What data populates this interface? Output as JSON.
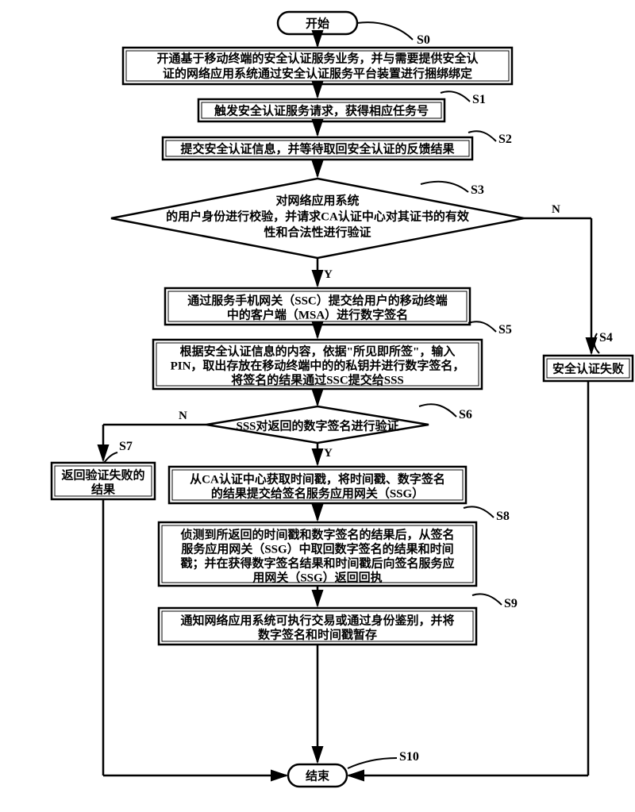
{
  "chart_data": {
    "type": "flowchart",
    "title": "",
    "nodes": [
      {
        "id": "start",
        "shape": "terminator",
        "text": "开始"
      },
      {
        "id": "S0",
        "shape": "process",
        "label": "S0",
        "text": "开通基于移动终端的安全认证服务业务，并与需要提供安全认证的网络应用系统通过安全认证服务平台装置进行捆绑绑定"
      },
      {
        "id": "S1",
        "shape": "process",
        "label": "S1",
        "text": "触发安全认证服务请求，获得相应任务号"
      },
      {
        "id": "S2",
        "shape": "process",
        "label": "S2",
        "text": "提交安全认证信息，并等待取回安全认证的反馈结果"
      },
      {
        "id": "S3",
        "shape": "decision",
        "label": "S3",
        "text": "对网络应用系统的用户身份进行校验，并请求CA认证中心对其证书的有效性和合法性进行验证"
      },
      {
        "id": "S3_Y",
        "shape": "process",
        "text": "通过服务手机网关（SSC）提交给用户的移动终端中的客户端（MSA）进行数字签名"
      },
      {
        "id": "S4",
        "shape": "process",
        "label": "S4",
        "text": "安全认证失败"
      },
      {
        "id": "S5",
        "shape": "process",
        "label": "S5",
        "text": "根据安全认证信息的内容，依据\"所见即所签\"，输入PIN，取出存放在移动终端中的的私钥并进行数字签名，将签名的结果通过SSC提交给SSS"
      },
      {
        "id": "S6",
        "shape": "decision",
        "label": "S6",
        "text": "SSS对返回的数字签名进行验证"
      },
      {
        "id": "S7",
        "shape": "process",
        "label": "S7",
        "text": "返回验证失败的结果"
      },
      {
        "id": "S6_Y",
        "shape": "process",
        "text": "从CA认证中心获取时间戳，将时间戳、数字签名的结果提交给签名服务应用网关（SSG）"
      },
      {
        "id": "S8",
        "shape": "process",
        "label": "S8",
        "text": "侦测到所返回的时间戳和数字签名的结果后，从签名服务应用网关（SSG）中取回数字签名的结果和时间戳；并在获得数字签名结果和时间戳后向签名服务应用网关（SSG）返回回执"
      },
      {
        "id": "S9",
        "shape": "process",
        "label": "S9",
        "text": "通知网络应用系统可执行交易或通过身份鉴别，并将数字签名和时间戳暂存"
      },
      {
        "id": "end",
        "shape": "terminator",
        "label": "S10",
        "text": "结束"
      }
    ],
    "edges": [
      {
        "from": "start",
        "to": "S0"
      },
      {
        "from": "S0",
        "to": "S1"
      },
      {
        "from": "S1",
        "to": "S2"
      },
      {
        "from": "S2",
        "to": "S3"
      },
      {
        "from": "S3",
        "to": "S3_Y",
        "label": "Y"
      },
      {
        "from": "S3",
        "to": "S4",
        "label": "N"
      },
      {
        "from": "S3_Y",
        "to": "S5"
      },
      {
        "from": "S5",
        "to": "S6"
      },
      {
        "from": "S6",
        "to": "S6_Y",
        "label": "Y"
      },
      {
        "from": "S6",
        "to": "S7",
        "label": "N"
      },
      {
        "from": "S6_Y",
        "to": "S8"
      },
      {
        "from": "S8",
        "to": "S9"
      },
      {
        "from": "S9",
        "to": "end"
      },
      {
        "from": "S4",
        "to": "end"
      },
      {
        "from": "S7",
        "to": "end"
      }
    ]
  },
  "start": "开始",
  "end": "结束",
  "S0_l1": "开通基于移动终端的安全认证服务业务，并与需要提供安全认",
  "S0_l2": "证的网络应用系统通过安全认证服务平台装置进行捆绑绑定",
  "S1_l1": "触发安全认证服务请求，获得相应任务号",
  "S2_l1": "提交安全认证信息，并等待取回安全认证的反馈结果",
  "S3_l1": "对网络应用系统",
  "S3_l2": "的用户身份进行校验，并请求CA认证中心对其证书的有效",
  "S3_l3": "性和合法性进行验证",
  "S3Y_l1": "通过服务手机网关（SSC）提交给用户的移动终端",
  "S3Y_l2": "中的客户端（MSA）进行数字签名",
  "S4_l1": "安全认证失败",
  "S5_l1": "根据安全认证信息的内容，依据\"所见即所签\"，输入",
  "S5_l2": "PIN，取出存放在移动终端中的的私钥并进行数字签名，",
  "S5_l3": "将签名的结果通过SSC提交给SSS",
  "S6_l1": "SSS对返回的数字签名进行验证",
  "S7_l1": "返回验证失败的",
  "S7_l2": "结果",
  "S6Y_l1": "从CA认证中心获取时间戳，将时间戳、数字签名",
  "S6Y_l2": "的结果提交给签名服务应用网关（SSG）",
  "S8_l1": "侦测到所返回的时间戳和数字签名的结果后，从签名",
  "S8_l2": "服务应用网关（SSG）中取回数字签名的结果和时间",
  "S8_l3": "戳；并在获得数字签名结果和时间戳后向签名服务应",
  "S8_l4": "用网关（SSG）返回回执",
  "S9_l1": "通知网络应用系统可执行交易或通过身份鉴别，并将",
  "S9_l2": "数字签名和时间戳暂存",
  "labels": {
    "S0": "S0",
    "S1": "S1",
    "S2": "S2",
    "S3": "S3",
    "S4": "S4",
    "S5": "S5",
    "S6": "S6",
    "S7": "S7",
    "S8": "S8",
    "S9": "S9",
    "S10": "S10",
    "Y": "Y",
    "N": "N"
  }
}
